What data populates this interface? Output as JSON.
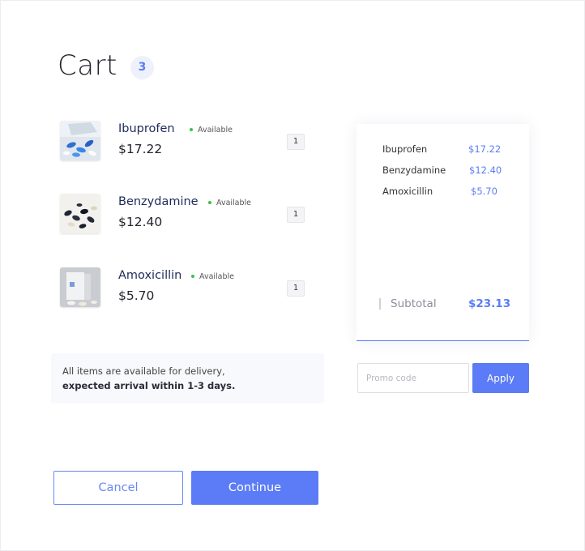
{
  "header": {
    "title": "Cart",
    "count": "3"
  },
  "items": [
    {
      "name": "Ibuprofen",
      "status": "Available",
      "price": "$17.22",
      "quantity": "1",
      "image": "blue-capsules-photo"
    },
    {
      "name": "Benzydamine",
      "status": "Available",
      "price": "$12.40",
      "quantity": "1",
      "image": "dark-capsules-photo"
    },
    {
      "name": "Amoxicillin",
      "status": "Available",
      "price": "$5.70",
      "quantity": "1",
      "image": "pill-box-photo"
    }
  ],
  "delivery_note": {
    "line1": "All items are available for delivery,",
    "line2": "expected arrival within 1-3 days."
  },
  "summary": {
    "rows": [
      {
        "name": "Ibuprofen",
        "price": "$17.22"
      },
      {
        "name": "Benzydamine",
        "price": "$12.40"
      },
      {
        "name": "Amoxicillin",
        "price": "$5.70"
      }
    ],
    "subtotal_label": "Subtotal",
    "subtotal_value": "$23.13"
  },
  "promo": {
    "placeholder": "Promo code",
    "value": "",
    "apply_label": "Apply"
  },
  "actions": {
    "cancel_label": "Cancel",
    "continue_label": "Continue"
  },
  "colors": {
    "accent": "#5b7cf6",
    "available_dot": "#3fbf4a",
    "item_name": "#1f2a5a",
    "badge_bg": "#eef1fb"
  }
}
